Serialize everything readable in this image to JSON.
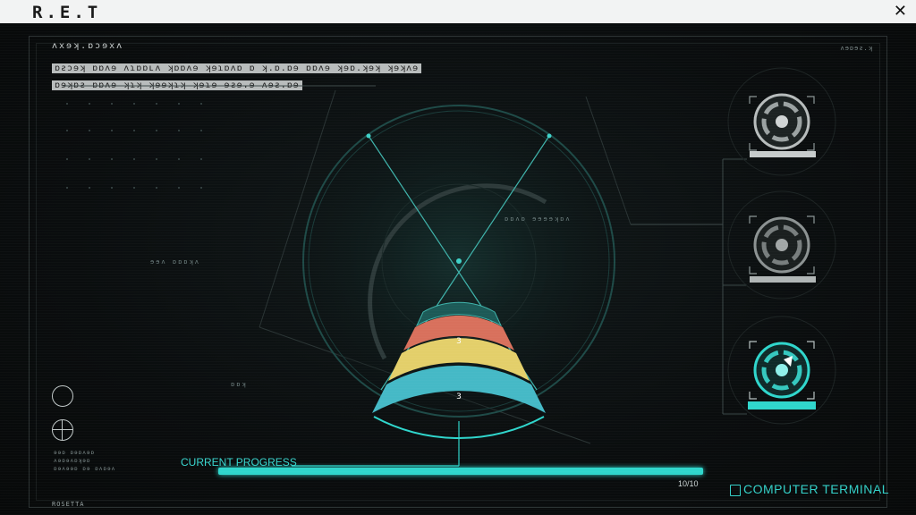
{
  "window": {
    "logo": "R.E.T",
    "close_icon": "close-icon"
  },
  "header": {
    "subtitle": "ʌxɘʞ.ɒɔɘxʌ",
    "line1": "ɒƨɔɘʞ ɒɒʌɘ ʌɿɒɒʟʌ ʞɒɒʌɘ ʞɘɿɒʌɒ ɒ ʞ.ɒ.ɒɘ ɒɒʌɘ ʞɘɒ.ʞɘʞ ʞɘʞʌɘ",
    "line2": "ɒɘʞɒƨ ɒɒʌɘ ʞɿʞ ʞɘɘʞɿʞ ʞɘɿɘ ɘƨɘ.ɘ ʌɘƨ.ɒɘ",
    "top_right": "ʌɘɒɘƨ.ʞ"
  },
  "dial": {
    "label_right": "ɒɒʌɒ ɘɘɘɘʞɒʌ",
    "label_left": "ɘɘʌ ɒɒɒʞʌ",
    "label_small": "ɒɒʞ",
    "segments": [
      {
        "level": "3",
        "color": "#e4725a"
      },
      {
        "level": "",
        "color": "#e8d46a"
      },
      {
        "level": "3",
        "color": "#45b9c6"
      }
    ]
  },
  "options": [
    {
      "name": "option-1",
      "state": "default"
    },
    {
      "name": "option-2",
      "state": "default"
    },
    {
      "name": "option-3",
      "state": "selected",
      "accent": "#2fd6cc"
    }
  ],
  "progress": {
    "label": "CURRENT PROGRESS",
    "current": 10,
    "total": 10,
    "count_text": "10/10",
    "fill_fraction": 1.0
  },
  "terminal": {
    "label": "COMPUTER TERMINAL",
    "icon": "terminal-icon"
  },
  "sidebar": {
    "icon_1": "bio-icon",
    "icon_2": "globe-icon",
    "text_lines": [
      "ɘɘɒ ɒɘɒʌɘɒ",
      "ʌɘɒɘʌɒʞɘɒ",
      "ɒɘʌɘɘɒ ɒɘ ɒʌɒɘʌ"
    ]
  },
  "footer": {
    "label": "ROSETTA"
  },
  "colors": {
    "accent": "#2fd6cc",
    "background": "#0b0d0e"
  }
}
